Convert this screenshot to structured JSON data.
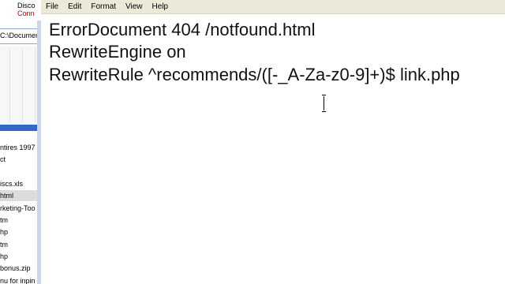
{
  "background_window": {
    "title_line1": "Disco",
    "title_line2": "Conn",
    "address": "C:\\Documen",
    "files": [
      "ntires 1997",
      "ct",
      "",
      "iscs.xls",
      "html",
      "rketing-Too",
      "tm",
      "hp",
      "tm",
      "hp",
      "bonus.zip",
      "nu for inpin"
    ],
    "selected_index": 4
  },
  "notepad": {
    "menu": [
      "File",
      "Edit",
      "Format",
      "View",
      "Help"
    ],
    "lines": [
      "ErrorDocument 404 /notfound.html",
      "RewriteEngine on",
      "RewriteRule ^recommends/([-_A-Za-z0-9]+)$ link.php"
    ]
  },
  "colors": {
    "menubar": "#ece9d8",
    "selection_blue": "#3169c6",
    "connect_red": "#c00000"
  },
  "icons": {
    "cursor": "i-beam-cursor-icon"
  }
}
